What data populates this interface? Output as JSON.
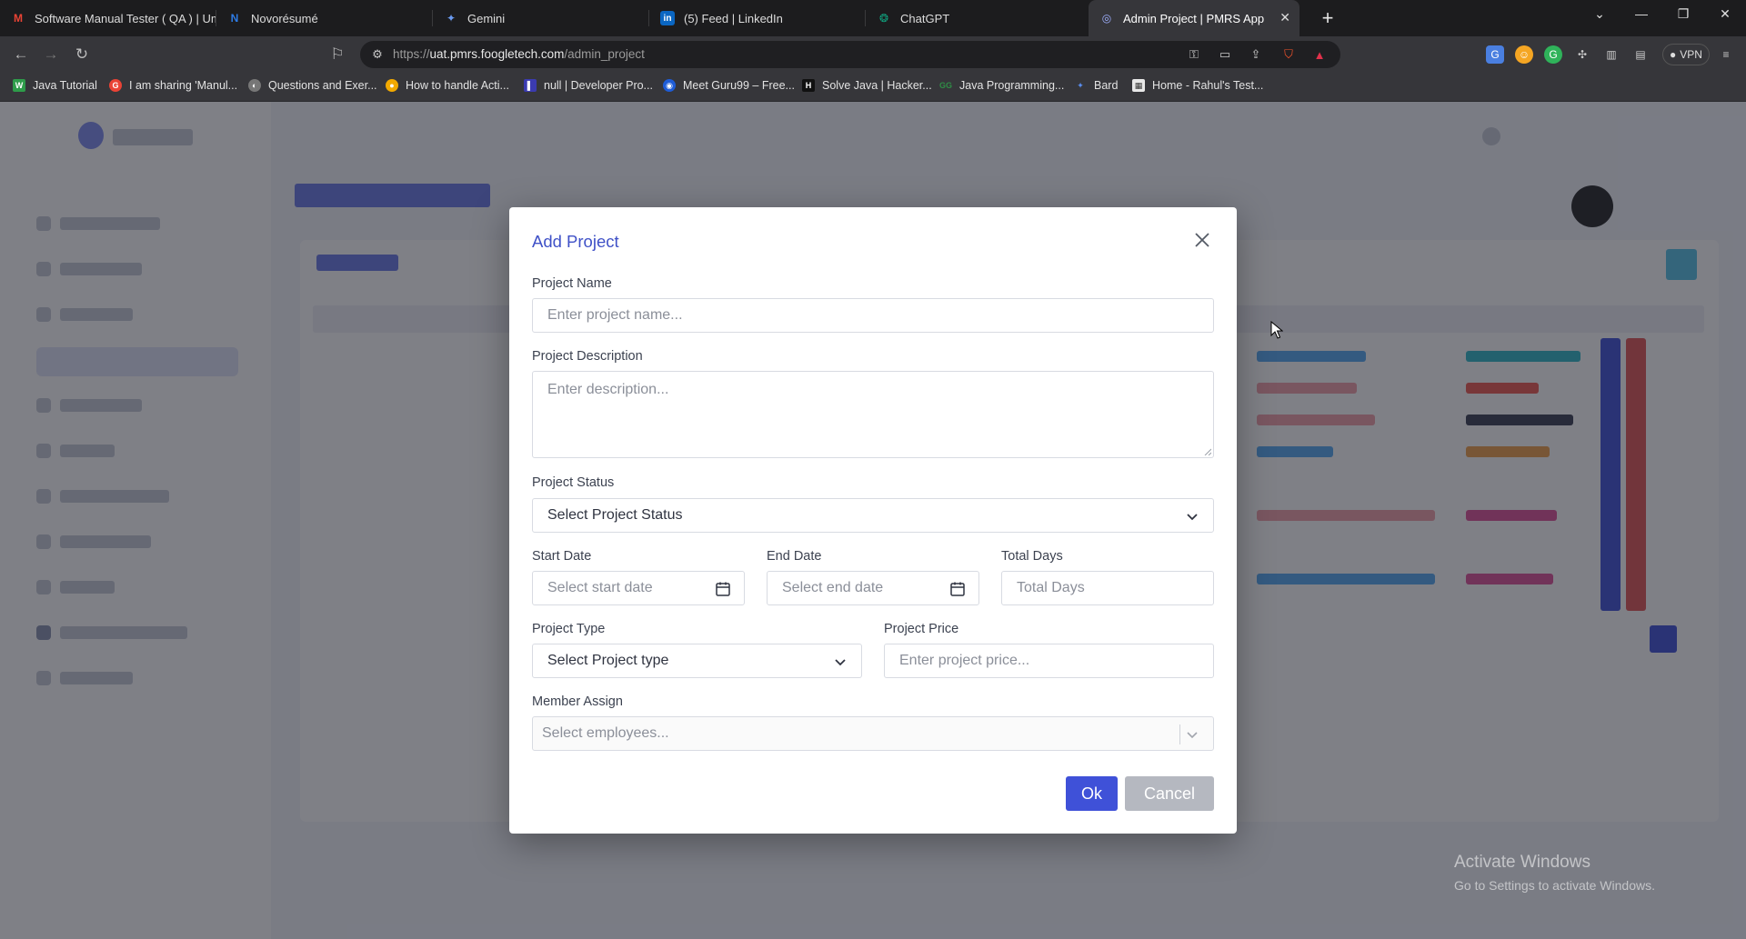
{
  "browser": {
    "tabs": [
      {
        "title": "Software Manual Tester ( QA ) | Umr",
        "icon": "gmail-icon",
        "color": "#ea4335"
      },
      {
        "title": "Novorésumé",
        "icon": "novoresume-icon",
        "color": "#2d7be5"
      },
      {
        "title": "Gemini",
        "icon": "gemini-icon",
        "color": "#6b9bf2"
      },
      {
        "title": "(5) Feed | LinkedIn",
        "icon": "linkedin-icon",
        "color": "#0a66c2"
      },
      {
        "title": "ChatGPT",
        "icon": "chatgpt-icon",
        "color": "#10a37f"
      },
      {
        "title": "Admin Project | PMRS App",
        "icon": "pmrs-icon",
        "color": "#7d8cf0"
      }
    ],
    "url_prefix": "https://",
    "url_host": "uat.pmrs.foogletech.com",
    "url_path": "/admin_project",
    "vpn_label": "VPN",
    "bookmarks": [
      {
        "label": "Java Tutorial",
        "color": "#2e9c4a"
      },
      {
        "label": "I am sharing 'Manul...",
        "color": "#ea4335"
      },
      {
        "label": "Questions and Exer...",
        "color": "#777777"
      },
      {
        "label": "How to handle Acti...",
        "color": "#f2a900"
      },
      {
        "label": "null | Developer Pro...",
        "color": "#3b3bb0"
      },
      {
        "label": "Meet Guru99 – Free...",
        "color": "#1e5cd6"
      },
      {
        "label": "Solve Java | Hacker...",
        "color": "#111111"
      },
      {
        "label": "Java Programming...",
        "color": "#2f8d46"
      },
      {
        "label": "Bard",
        "color": "#5a8dee"
      },
      {
        "label": "Home - Rahul's Test...",
        "color": "#e8e8e8"
      }
    ]
  },
  "modal": {
    "title": "Add Project",
    "fields": {
      "project_name": {
        "label": "Project Name",
        "placeholder": "Enter project name..."
      },
      "project_description": {
        "label": "Project Description",
        "placeholder": "Enter description..."
      },
      "project_status": {
        "label": "Project Status",
        "selected": "Select Project Status"
      },
      "start_date": {
        "label": "Start Date",
        "placeholder": "Select start date"
      },
      "end_date": {
        "label": "End Date",
        "placeholder": "Select end date"
      },
      "total_days": {
        "label": "Total Days",
        "placeholder": "Total Days"
      },
      "project_type": {
        "label": "Project Type",
        "selected": "Select Project type"
      },
      "project_price": {
        "label": "Project Price",
        "placeholder": "Enter project price..."
      },
      "member_assign": {
        "label": "Member Assign",
        "placeholder": "Select employees..."
      }
    },
    "ok_label": "Ok",
    "cancel_label": "Cancel"
  },
  "windows_watermark": {
    "line1": "Activate Windows",
    "line2": "Go to Settings to activate Windows."
  },
  "colors": {
    "accent": "#3f51d8",
    "title": "#3f51c7",
    "cancel": "#b5b8c0"
  }
}
